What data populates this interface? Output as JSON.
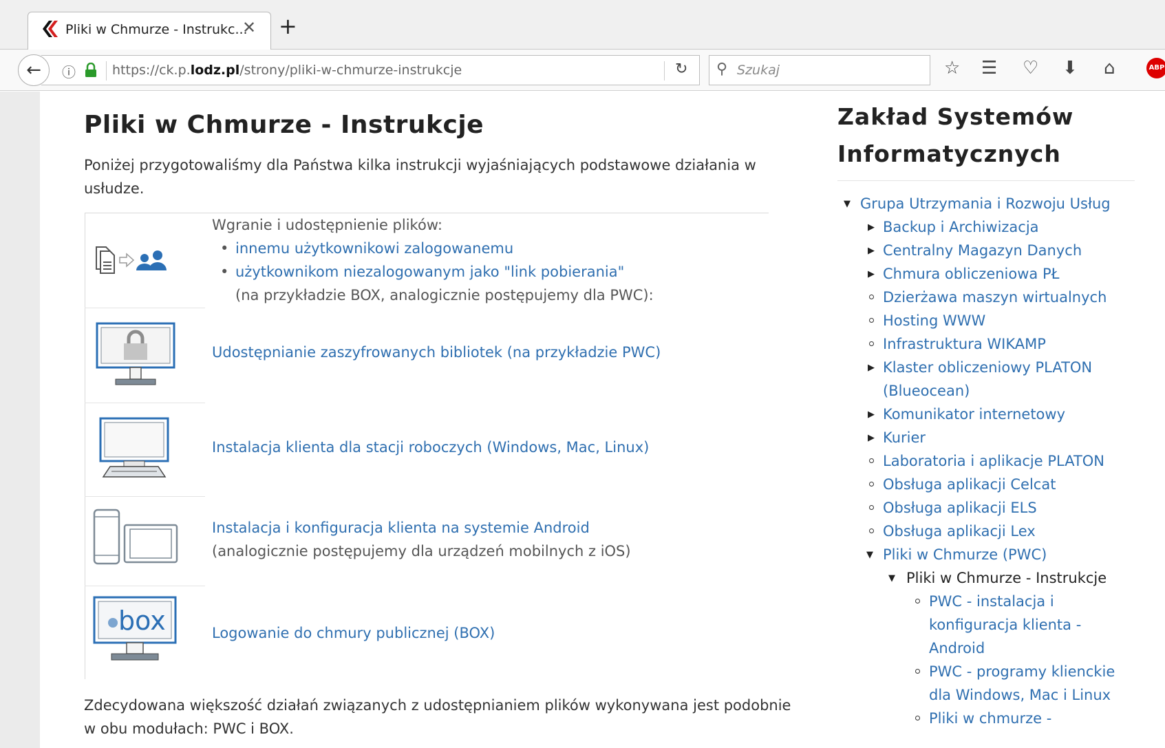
{
  "browser": {
    "tab_title": "Pliki w Chmurze - Instrukc...",
    "tab_close": "✕",
    "new_tab": "+",
    "url_prefix": "https://ck.p.",
    "url_domain": "lodz.pl",
    "url_path": "/strony/pliki-w-chmurze-instrukcje",
    "search_placeholder": "Szukaj"
  },
  "main": {
    "title": "Pliki w Chmurze - Instrukcje",
    "intro": "Poniżej przygotowaliśmy dla Państwa kilka instrukcji wyjaśniających podstawowe działania w usłudze.",
    "sharing": {
      "heading": "Wgranie i udostępnienie plików:",
      "items": [
        "innemu użytkownikowi zalogowanemu",
        "użytkownikom niezalogowanym jako \"link pobierania\""
      ],
      "note": "(na przykładzie BOX, analogicznie postępujemy dla PWC):"
    },
    "rows": [
      {
        "link": "Udostępnianie zaszyfrowanych bibliotek (na przykładzie PWC)"
      },
      {
        "link": "Instalacja klienta dla stacji roboczych (Windows, Mac, Linux)"
      },
      {
        "link": "Instalacja i konfiguracja klienta na systemie Android",
        "note": "(analogicznie postępujemy dla urządzeń mobilnych z iOS)"
      },
      {
        "link": "Logowanie do chmury publicznej (BOX)",
        "icon_text": "box"
      }
    ],
    "footer": "Zdecydowana większość działań związanych z udostępnianiem plików wykonywana jest podobnie w obu modułach: PWC i BOX."
  },
  "sidebar": {
    "title_line1": "Zakład Systemów",
    "title_line2": "Informatycznych",
    "group": "Grupa Utrzymania i Rozwoju Usług",
    "items": [
      "Backup i Archiwizacja",
      "Centralny Magazyn Danych",
      "Chmura obliczeniowa PŁ",
      "Dzierżawa maszyn wirtualnych",
      "Hosting WWW",
      "Infrastruktura WIKAMP",
      "Klaster obliczeniowy PLATON",
      "(Blueocean)",
      "Komunikator internetowy",
      "Kurier",
      "Laboratoria i aplikacje PLATON",
      "Obsługa aplikacji Celcat",
      "Obsługa aplikacji ELS",
      "Obsługa aplikacji Lex",
      "Pliki w Chmurze (PWC)"
    ],
    "current": "Pliki w Chmurze - Instrukcje",
    "subitems": [
      "PWC - instalacja i",
      "konfiguracja klienta -",
      "Android",
      "PWC - programy klienckie",
      "dla Windows, Mac i Linux",
      "Pliki w chmurze -"
    ]
  }
}
